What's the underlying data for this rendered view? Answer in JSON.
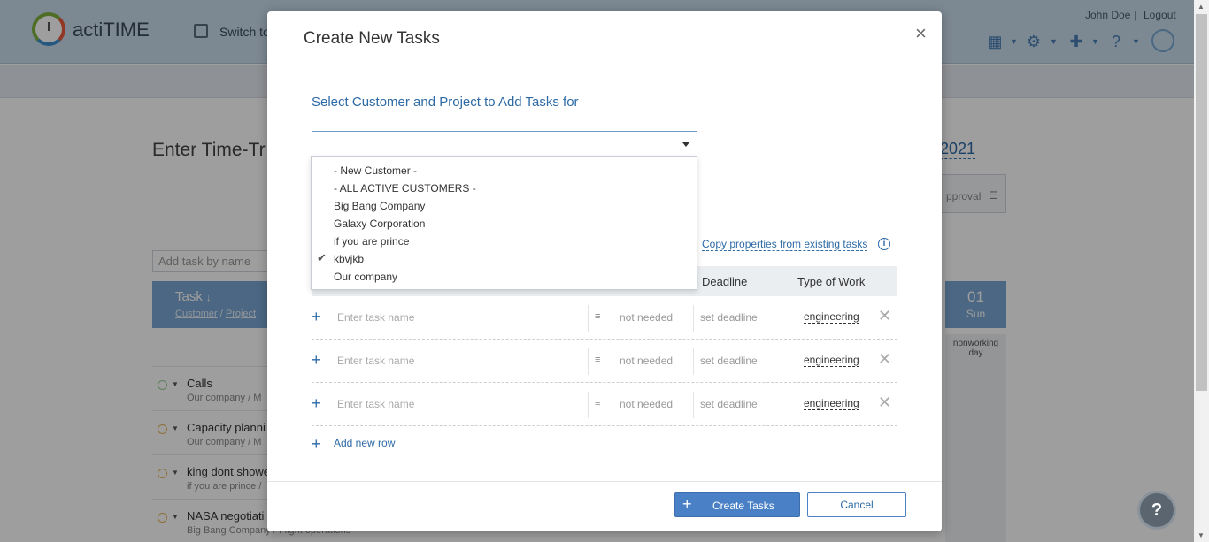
{
  "app": {
    "logo_text": "actiTIME",
    "switch_text": "Switch to",
    "user_name": "John Doe",
    "user_sep": "|",
    "logout": "Logout",
    "colors": {
      "header": "#c8dbec",
      "accent": "#2d6aa6",
      "primary_button": "#4a80c5"
    }
  },
  "background": {
    "page_title": "Enter Time-Tr",
    "year": "2021",
    "approval": "pproval",
    "add_task_placeholder": "Add task by name",
    "task_col": "Task",
    "task_col_sort": "↓",
    "task_sub_customer": "Customer",
    "task_sub_sep": " / ",
    "task_sub_project": "Project",
    "day_num": "01",
    "day_name": "Sun",
    "nonworking": "nonworking day",
    "tasks": [
      {
        "name": "Calls",
        "sub": "Our company  /  M",
        "icon": "green"
      },
      {
        "name": "Capacity planni",
        "sub": "Our company  /  M",
        "icon": "orange"
      },
      {
        "name": "king dont showe",
        "sub": "if you are prince  /",
        "icon": "orange"
      },
      {
        "name": "NASA negotiati",
        "sub": "Big Bang Company  /  Flight operations",
        "icon": "orange"
      }
    ]
  },
  "modal": {
    "title": "Create New Tasks",
    "close_icon": "×",
    "select_label": "Select Customer and Project to Add Tasks for",
    "combo_value": "",
    "copy_link": "Copy properties from existing tasks",
    "info_icon": "i",
    "col_deadline": "Deadline",
    "col_type": "Type of Work",
    "rows": [
      {
        "placeholder": "Enter task name",
        "estimate": "not needed",
        "deadline": "set deadline",
        "type": "engineering"
      },
      {
        "placeholder": "Enter task name",
        "estimate": "not needed",
        "deadline": "set deadline",
        "type": "engineering"
      },
      {
        "placeholder": "Enter task name",
        "estimate": "not needed",
        "deadline": "set deadline",
        "type": "engineering"
      }
    ],
    "add_row": "Add new row",
    "create_button": "Create Tasks",
    "cancel_button": "Cancel"
  },
  "dropdown": {
    "options": [
      {
        "label": "- New Customer -",
        "checked": false
      },
      {
        "label": "- ALL ACTIVE CUSTOMERS -",
        "checked": false
      },
      {
        "label": "Big Bang Company",
        "checked": false
      },
      {
        "label": "Galaxy Corporation",
        "checked": false
      },
      {
        "label": "if you are prince",
        "checked": false
      },
      {
        "label": "kbvjkb",
        "checked": true
      },
      {
        "label": "Our company",
        "checked": false
      }
    ]
  },
  "help_fab": "?"
}
